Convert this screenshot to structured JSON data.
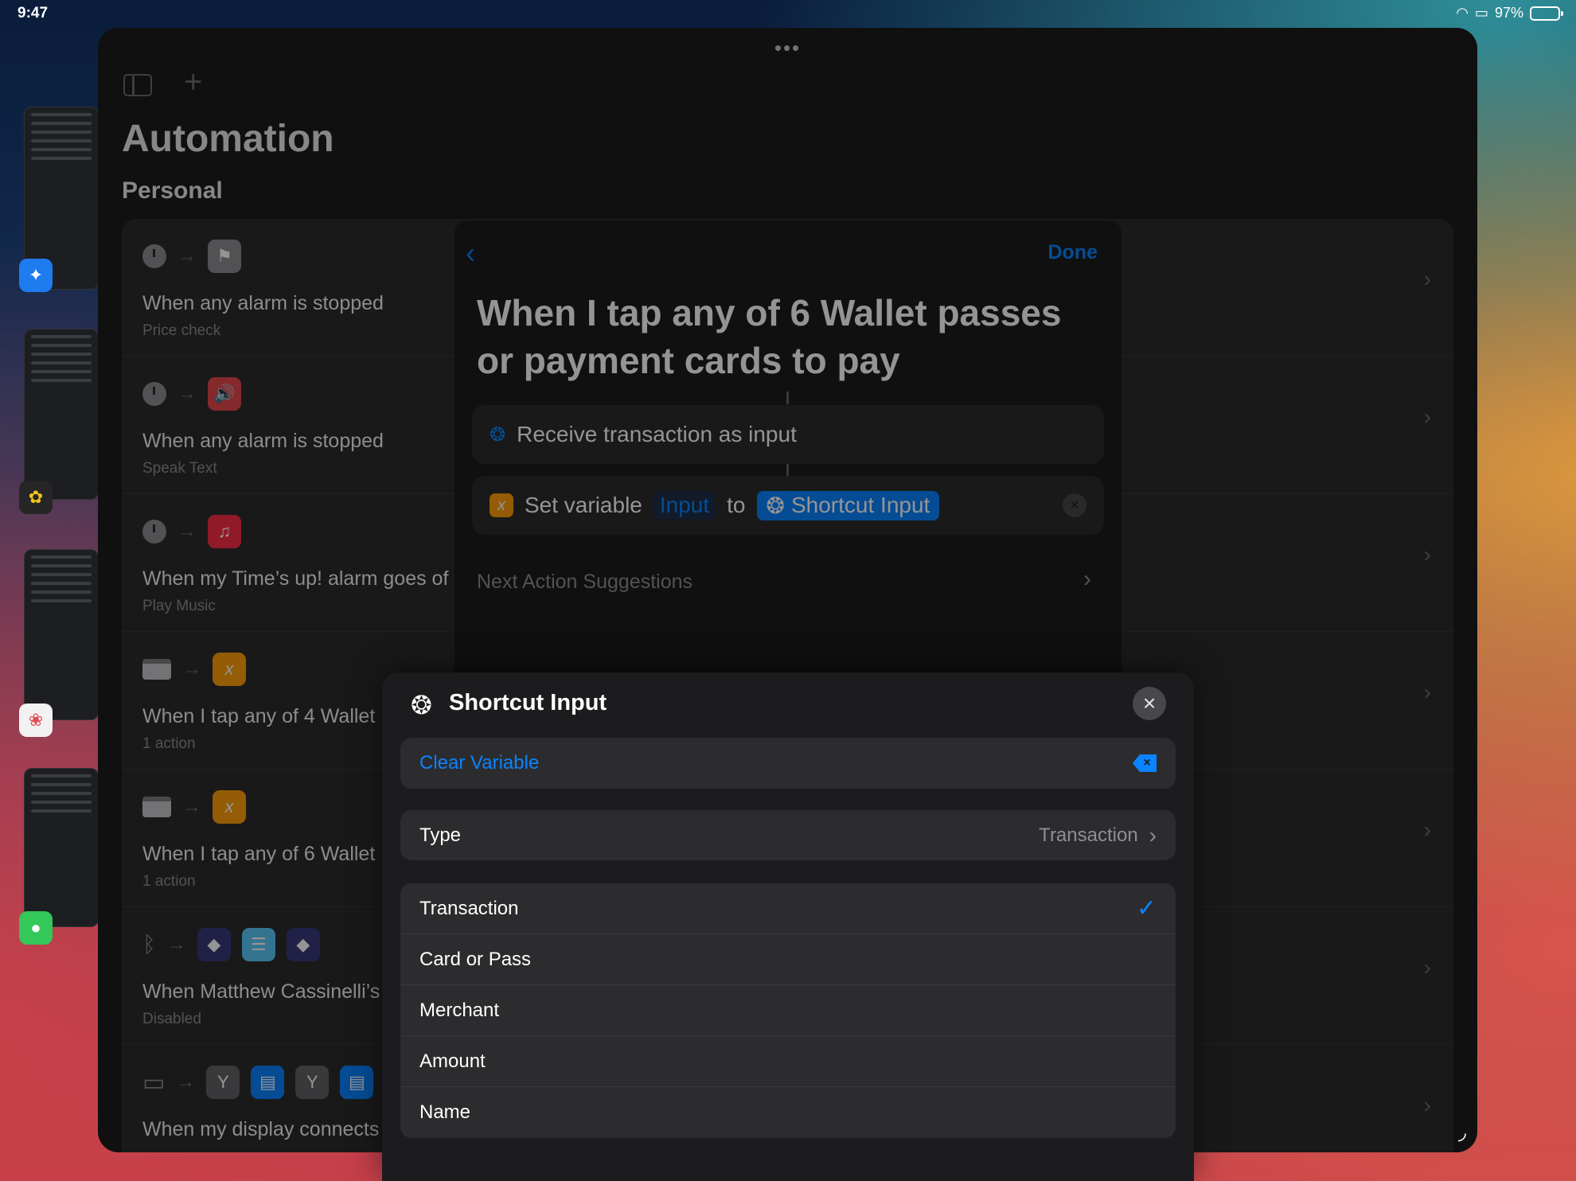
{
  "status_bar": {
    "time": "9:47",
    "battery": "97%"
  },
  "window": {
    "title": "Automation",
    "section": "Personal",
    "rows": [
      {
        "title": "When any alarm is stopped",
        "subtitle": "Price check",
        "icon": "flag-icon"
      },
      {
        "title": "When any alarm is stopped",
        "subtitle": "Speak Text",
        "icon": "speaker-icon"
      },
      {
        "title": "When my Time’s up! alarm goes of",
        "subtitle": "Play Music",
        "icon": "music-note-icon"
      },
      {
        "title": "When I tap any of 4 Wallet",
        "subtitle": "1 action",
        "icon": "variable-icon"
      },
      {
        "title": "When I tap any of 6 Wallet",
        "subtitle": "1 action",
        "icon": "variable-icon"
      },
      {
        "title": "When Matthew Cassinelli’s",
        "subtitle": "Disabled",
        "icon": "shortcuts-icon"
      },
      {
        "title": "When my display connects",
        "subtitle": "",
        "icon": "display-icon"
      }
    ]
  },
  "editor": {
    "done_label": "Done",
    "title": "When I tap any of 6 Wallet passes or payment cards to pay",
    "action1": "Receive transaction as input",
    "action2": {
      "prefix": "Set variable",
      "variable": "Input",
      "to": "to",
      "value": "Shortcut Input"
    },
    "suggestions": "Next Action Suggestions"
  },
  "popover": {
    "title": "Shortcut Input",
    "clear_label": "Clear Variable",
    "type_label": "Type",
    "type_value": "Transaction",
    "options": [
      "Transaction",
      "Card or Pass",
      "Merchant",
      "Amount",
      "Name"
    ],
    "selected": "Transaction"
  },
  "colors": {
    "accent": "#0a84ff",
    "variable": "#ff9f0a"
  }
}
